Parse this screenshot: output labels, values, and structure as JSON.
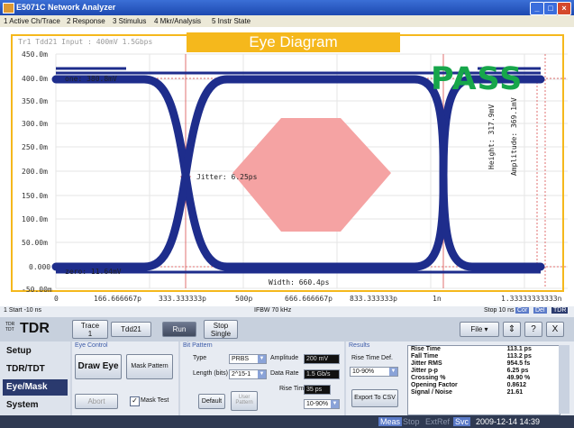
{
  "window": {
    "title": "E5071C Network Analyzer",
    "min": "_",
    "max": "□",
    "close": "×"
  },
  "menu": [
    "1 Active Ch/Trace",
    "2 Response",
    "3 Stimulus",
    "4 Mkr/Analysis",
    "5 Instr State"
  ],
  "plot": {
    "header": "Tr1 Tdd21  Input : 400mV 1.5Gbps",
    "banner": "Eye Diagram",
    "pass": "PASS",
    "y_ticks": [
      "450.0m",
      "400.0m",
      "350.0m",
      "300.0m",
      "250.0m",
      "200.0m",
      "150.0m",
      "100.0m",
      "50.00m",
      "0.000",
      "-50.00m"
    ],
    "x_ticks": [
      "0",
      "166.666667p",
      "333.333333p",
      "500p",
      "666.666667p",
      "833.333333p",
      "1n",
      "1.33333333333n"
    ],
    "one_label": "one: 380.8mV",
    "zero_label": "zero: 11.64mV",
    "jitter_label": "Jitter: 6.25ps",
    "width_label": "Width: 660.4ps",
    "height_label": "Height: 317.9mV",
    "amplitude_label": "Amplitude: 369.1mV",
    "colors": {
      "trace": "#1e2d8c",
      "mask": "#f08f8f",
      "banner": "#f5b81c",
      "pass": "#17a64a"
    }
  },
  "status": {
    "start": "1 Start -10 ns",
    "ifbw": "IFBW 70 kHz",
    "stop": "Stop 10 ns",
    "badges": [
      "Cor",
      "Del",
      "TDR"
    ]
  },
  "controls": {
    "logo": "TDR",
    "logo_sub1": "TDR",
    "logo_sub2": "TDT",
    "trace_label": "Trace",
    "trace_num": "1",
    "tdd21": "Tdd21",
    "run": "Run",
    "stop_single_1": "Stop",
    "stop_single_2": "Single",
    "file": "File",
    "help": "?",
    "close": "X"
  },
  "tabs": [
    "Setup",
    "TDR/TDT",
    "Eye/Mask",
    "System"
  ],
  "eye_control": {
    "group": "Eye Control",
    "draw": "Draw Eye",
    "mask_pattern": "Mask Pattern",
    "abort": "Abort",
    "mask_test": "Mask Test"
  },
  "bit_pattern": {
    "group": "Bit Pattern",
    "type_label": "Type",
    "type": "PRBS",
    "length_label": "Length (bits)",
    "length": "2^15-1",
    "amplitude_label": "Amplitude",
    "amplitude": "200 mV",
    "rate_label": "Data Rate",
    "rate": "1.5 Gb/s",
    "rise_label": "Rise Time",
    "rise": "35 ps",
    "rise_def": "10-90%",
    "default": "Default",
    "user_pattern": "User Pattern"
  },
  "results": {
    "group": "Results",
    "rise_def_label": "Rise Time Def.",
    "rise_def": "10-90%",
    "export": "Export To CSV",
    "rows": [
      [
        "Rise Time",
        "113.1 ps"
      ],
      [
        "Fall Time",
        "113.2 ps"
      ],
      [
        "Jitter RMS",
        "954.5 fs"
      ],
      [
        "Jitter p-p",
        "6.25 ps"
      ],
      [
        "Crossing %",
        "49.90 %"
      ],
      [
        "Opening Factor",
        "0.8612"
      ],
      [
        "Signal / Noise",
        "21.61"
      ]
    ]
  },
  "bottom": {
    "meas": "Meas",
    "stop": "Stop",
    "extref": "ExtRef",
    "svc": "Svc",
    "datetime": "2009-12-14 14:39"
  }
}
